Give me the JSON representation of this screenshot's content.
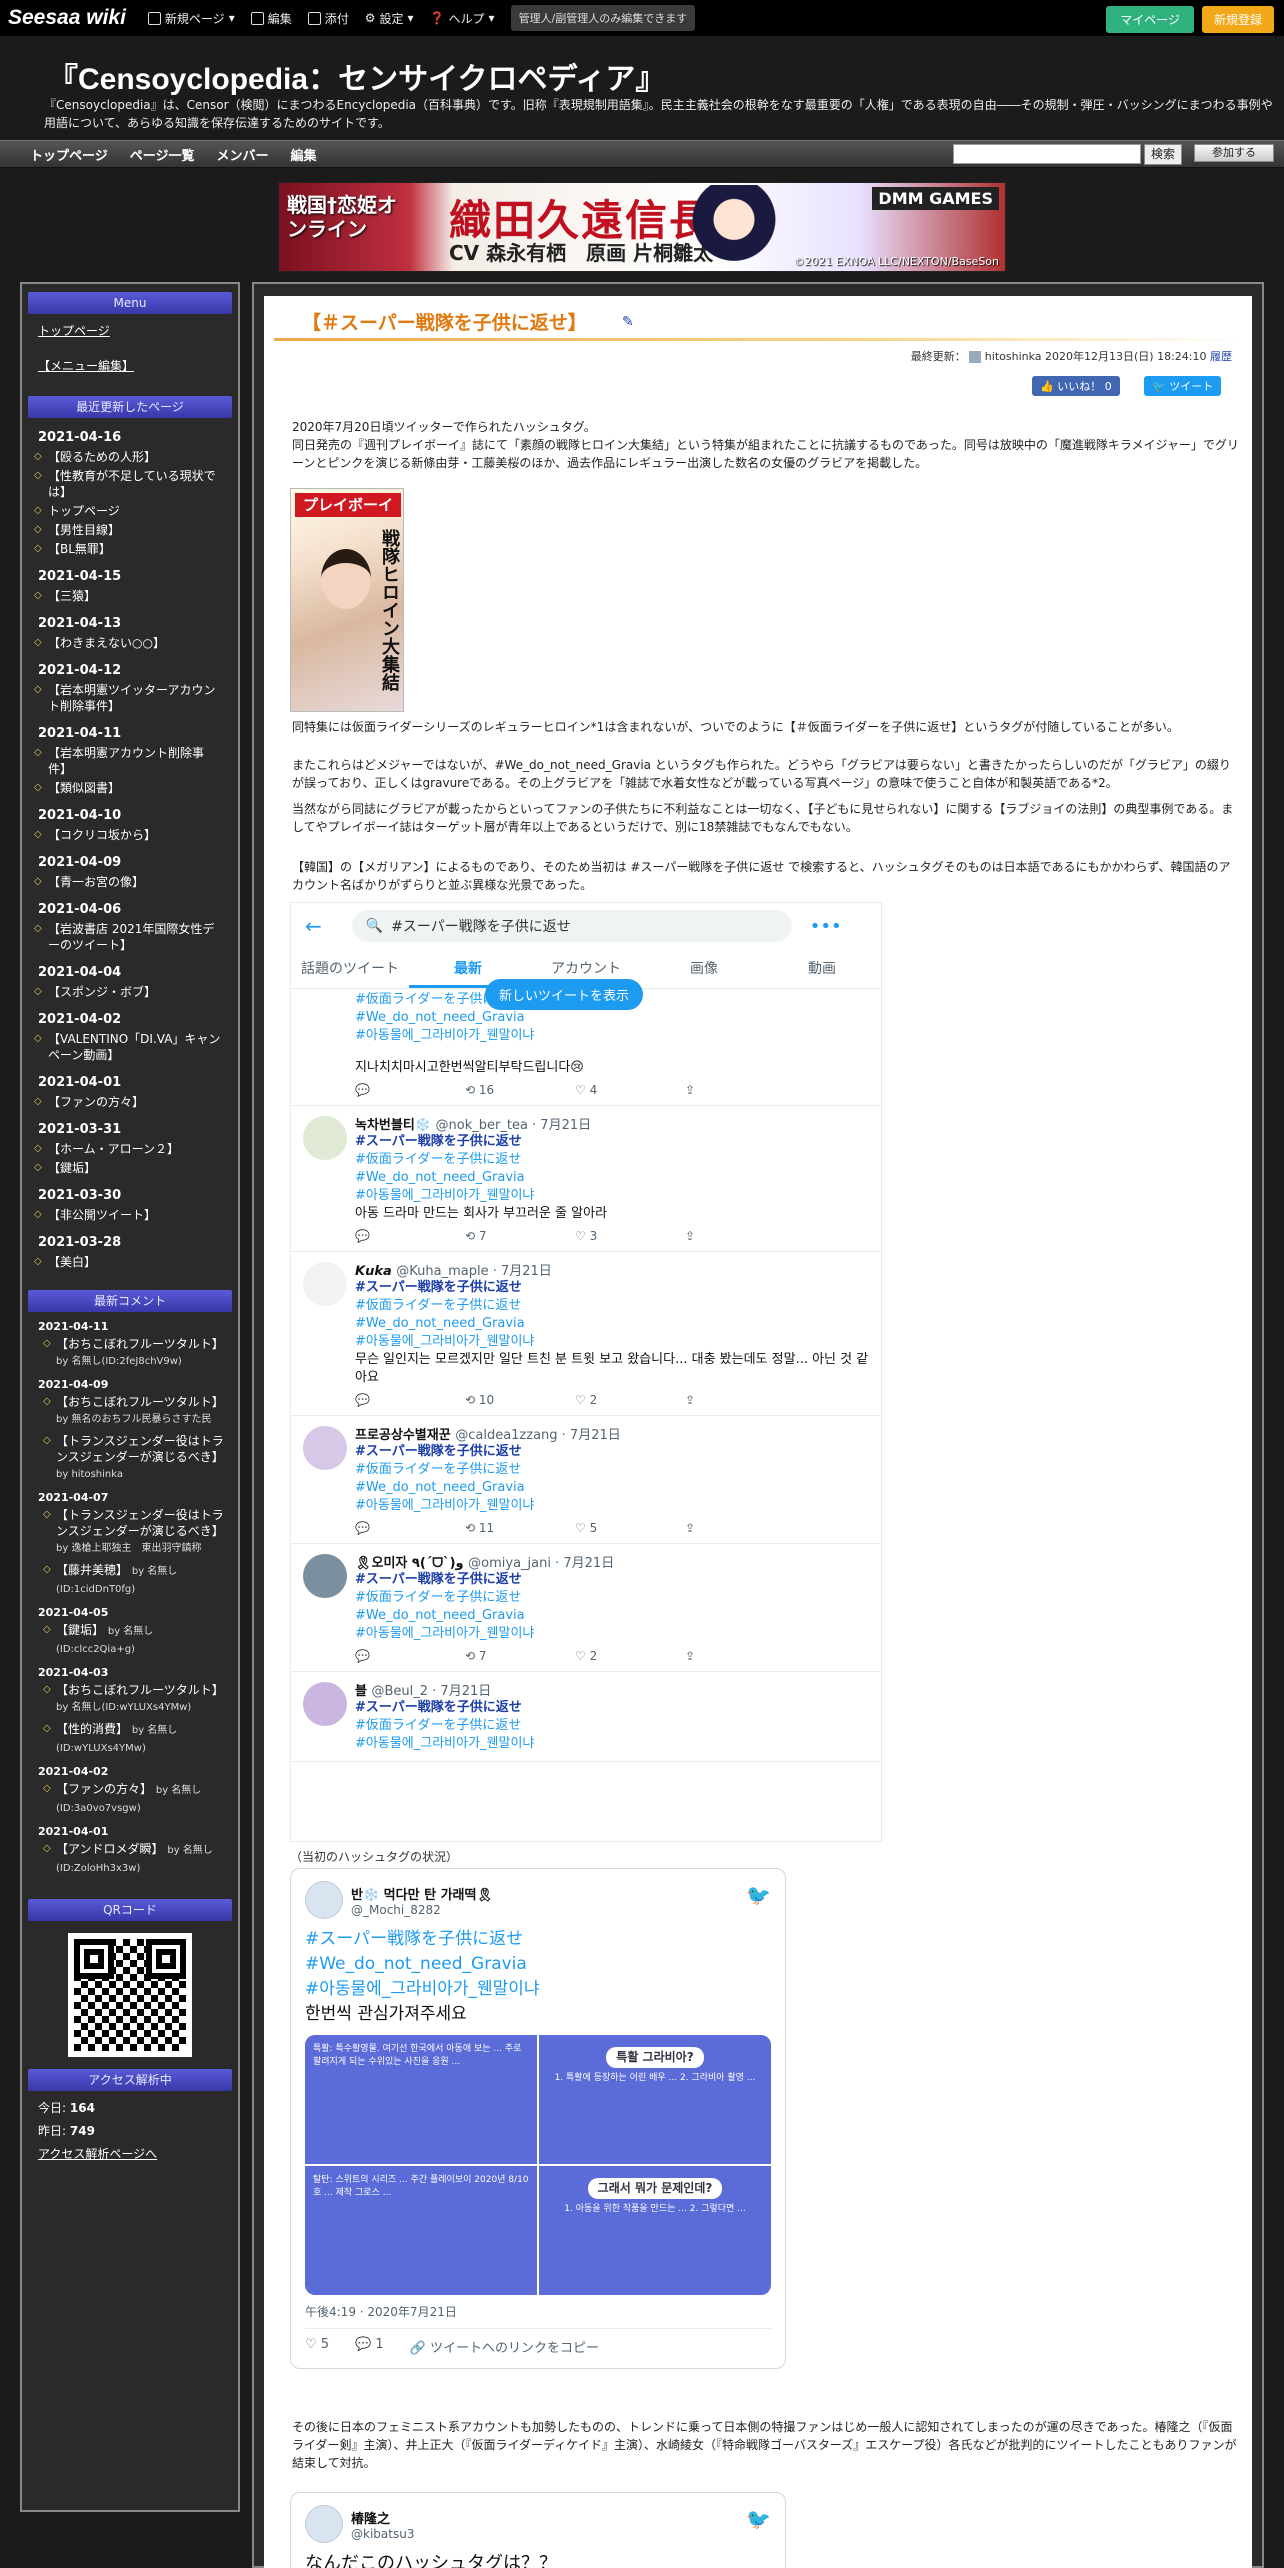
{
  "topbar": {
    "logo": "Seesaa wiki",
    "new_page": "新規ページ",
    "edit": "編集",
    "attach": "添付",
    "settings": "設定",
    "help": "ヘルプ",
    "note": "管理人/副管理人のみ編集できます",
    "mypage": "マイページ",
    "register": "新規登録"
  },
  "header": {
    "title": "『Censoyclopedia：センサイクロペディア』",
    "description": "『Censoyclopedia』は、Censor（検閲）にまつわるEncyclopedia（百科事典）です。旧称『表現規制用語集』。民主主義社会の根幹をなす最重要の「人権」である表現の自由――その規制・弾圧・バッシングにまつわる事例や用語について、あらゆる知識を保存伝達するためのサイトです。"
  },
  "nav": {
    "items": [
      "トップページ",
      "ページ一覧",
      "メンバー",
      "編集"
    ],
    "search_button": "検索",
    "join_button": "参加する"
  },
  "banner": {
    "left": "戦国†恋姫オンライン",
    "title_a": "織田",
    "title_b": "久遠",
    "title_c": "信長",
    "cast": "CV 森永有栖　原画 片桐雛太",
    "logo": "DMM GAMES",
    "copyright": "©2021 EXNOA LLC/NEXTON/BaseSon"
  },
  "sidebar": {
    "menu_head": "Menu",
    "menu_links": [
      "トップページ",
      "【メニュー編集】"
    ],
    "recent_head": "最近更新したページ",
    "recent": [
      {
        "date": "2021-04-16",
        "items": [
          "【殴るための人形】",
          "【性教育が不足している現状では】",
          "トップページ",
          "【男性目線】",
          "【BL無罪】"
        ]
      },
      {
        "date": "2021-04-15",
        "items": [
          "【三猿】"
        ]
      },
      {
        "date": "2021-04-13",
        "items": [
          "【わきまえない○○】"
        ]
      },
      {
        "date": "2021-04-12",
        "items": [
          "【岩本明憲ツイッターアカウント削除事件】"
        ]
      },
      {
        "date": "2021-04-11",
        "items": [
          "【岩本明憲アカウント削除事件】",
          "【類似図書】"
        ]
      },
      {
        "date": "2021-04-10",
        "items": [
          "【コクリコ坂から】"
        ]
      },
      {
        "date": "2021-04-09",
        "items": [
          "【青一お宮の像】"
        ]
      },
      {
        "date": "2021-04-06",
        "items": [
          "【岩波書店 2021年国際女性デーのツイート】"
        ]
      },
      {
        "date": "2021-04-04",
        "items": [
          "【スポンジ・ボブ】"
        ]
      },
      {
        "date": "2021-04-02",
        "items": [
          "【VALENTINO「DI.VA」キャンペーン動画】"
        ]
      },
      {
        "date": "2021-04-01",
        "items": [
          "【ファンの方々】"
        ]
      },
      {
        "date": "2021-03-31",
        "items": [
          "【ホーム・アローン２】",
          "【鍵垢】"
        ]
      },
      {
        "date": "2021-03-30",
        "items": [
          "【非公開ツイート】"
        ]
      },
      {
        "date": "2021-03-28",
        "items": [
          "【美白】"
        ]
      }
    ],
    "comments_head": "最新コメント",
    "comments": [
      {
        "date": "2021-04-11",
        "items": [
          {
            "t": "【おちこぼれフルーツタルト】",
            "by": "by 名無し(ID:2feJ8chV9w)"
          }
        ]
      },
      {
        "date": "2021-04-09",
        "items": [
          {
            "t": "【おちこぼれフルーツタルト】",
            "by": "by 無名のおちフル民暴らさすた民"
          },
          {
            "t": "【トランスジェンダー役はトランスジェンダーが演じるべき】",
            "by": "by hitoshinka"
          }
        ]
      },
      {
        "date": "2021-04-07",
        "items": [
          {
            "t": "【トランスジェンダー役はトランスジェンダーが演じるべき】",
            "by": "by 逸槍上耶独主　東出羽守鎮称"
          },
          {
            "t": "【藤井美穂】",
            "by": "by 名無し(ID:1cidDnT0fg)"
          }
        ]
      },
      {
        "date": "2021-04-05",
        "items": [
          {
            "t": "【鍵垢】",
            "by": "by 名無し(ID:clcc2Qia+g)"
          }
        ]
      },
      {
        "date": "2021-04-03",
        "items": [
          {
            "t": "【おちこぼれフルーツタルト】",
            "by": "by 名無し(ID:wYLUXs4YMw)"
          },
          {
            "t": "【性的消費】",
            "by": "by 名無し(ID:wYLUXs4YMw)"
          }
        ]
      },
      {
        "date": "2021-04-02",
        "items": [
          {
            "t": "【ファンの方々】",
            "by": "by 名無し(ID:3a0vo7vsgw)"
          }
        ]
      },
      {
        "date": "2021-04-01",
        "items": [
          {
            "t": "【アンドロメダ瞬】",
            "by": "by 名無し(ID:ZoloHh3x3w)"
          }
        ]
      }
    ],
    "qr_head": "QRコード",
    "access_head": "アクセス解析中",
    "today_label": "今日:",
    "today": "164",
    "yesterday_label": "昨日:",
    "yesterday": "749",
    "access_link": "アクセス解析ページへ"
  },
  "article": {
    "title": "【＃スーパー戦隊を子供に返せ】",
    "updated_label": "最終更新：",
    "updated_by": "hitoshinka",
    "updated_at": "2020年12月13日(日) 18:24:10",
    "history": "履歴",
    "like": "いいね！ 0",
    "tweet": "ツイート",
    "p1": "2020年7月20日頃ツイッターで作られたハッシュタグ。",
    "p2": "同日発売の『週刊プレイボーイ』誌にて「素顔の戦隊ヒロイン大集結」という特集が組まれたことに抗議するものであった。同号は放映中の「魔進戦隊キラメイジャー」でグリーンとピンクを演じる新條由芽・工藤美桜のほか、過去作品にレギュラー出演した数名の女優のグラビアを掲載した。",
    "magazine_title": "プレイボーイ",
    "magazine_side": "戦隊ヒロイン大集結",
    "p3": "同特集には仮面ライダーシリーズのレギュラーヒロイン*1は含まれないが、ついでのように【＃仮面ライダーを子供に返せ】というタグが付随していることが多い。",
    "p4": "またこれらはどメジャーではないが、#We_do_not_need_Gravia というタグも作られた。どうやら「グラビアは要らない」と書きたかったらしいのだが「グラビア」の綴りが誤っており、正しくはgravureである。その上グラビアを「雑誌で水着女性などが載っている写真ページ」の意味で使うこと自体が和製英語である*2。",
    "p5": "当然ながら同誌にグラビアが載ったからといってファンの子供たちに不利益なことは一切なく、【子どもに見せられない】に関する【ラブジョイの法則】の典型事例である。ましてやプレイボーイ誌はターゲット層が青年以上であるというだけで、別に18禁雑誌でもなんでもない。",
    "p6": "【韓国】の【メガリアン】によるものであり、そのため当初は #スーパー戦隊を子供に返せ で検索すると、ハッシュタグそのものは日本語であるにもかかわらず、韓国語のアカウント名ばかりがずらりと並ぶ異様な光景であった。",
    "caption1": "（当初のハッシュタグの状況）",
    "p7": "その後に日本のフェミニスト系アカウントも加勢したものの、トレンドに乗って日本側の特撮ファンはじめ一般人に認知されてしまったのが運の尽きであった。椿隆之（『仮面ライダー剣』主演）、井上正大（『仮面ライダーディケイド』主演）、水崎綾女（『特命戦隊ゴーバスターズ』エスケープ役）各氏などが批判的にツイートしたこともありファンが結束して対抗。"
  },
  "twitter_search": {
    "query": "#スーパー戦隊を子供に返せ",
    "tabs": [
      "話題のツイート",
      "最新",
      "アカウント",
      "画像",
      "動画"
    ],
    "new_tweets": "新しいツイートを表示",
    "tweets": [
      {
        "name": "",
        "handle": "",
        "tags": [
          "#仮面ライダーを子供に返せ",
          "#We_do_not_need_Gravia",
          "#아동물에_그라비아가_웬말이냐"
        ],
        "body": "지나치치마시고한번씩알티부탁드립니다😢",
        "rt": "16",
        "like": "4"
      },
      {
        "name": "녹차번블티❄️",
        "handle": "@nok_ber_tea · 7月21日",
        "tags": [
          "#スーパー戦隊を子供に返せ",
          "#仮面ライダーを子供に返せ",
          "#We_do_not_need_Gravia",
          "#아동물에_그라비아가_웬말이냐"
        ],
        "body": "아동 드라마 만드는 회사가 부끄러운 줄 알아라",
        "rt": "7",
        "like": "3"
      },
      {
        "name": "𝙆𝙪𝙠𝙖",
        "handle": "@Kuha_maple · 7月21日",
        "tags": [
          "#スーパー戦隊を子供に返せ",
          "#仮面ライダーを子供に返せ",
          "#We_do_not_need_Gravia",
          "#아동물에_그라비아가_웬말이냐"
        ],
        "body": "무슨 일인지는 모르겠지만 일단 트친 분 트윗 보고 왔습니다... 대충 봤는데도 정말... 아닌 것 같아요",
        "rt": "10",
        "like": "2"
      },
      {
        "name": "프로공상수별재꾼",
        "handle": "@caldea1zzang · 7月21日",
        "tags": [
          "#スーパー戦隊を子供に返せ",
          "#仮面ライダーを子供に返せ",
          "#We_do_not_need_Gravia",
          "#아동물에_그라비아가_웬말이냐"
        ],
        "body": "",
        "rt": "11",
        "like": "5"
      },
      {
        "name": "🎗오미자 ٩(ˊᗜˋ)و",
        "handle": "@omiya_jani · 7月21日",
        "tags": [
          "#スーパー戦隊を子供に返せ",
          "#仮面ライダーを子供に返せ",
          "#We_do_not_need_Gravia",
          "#아동물에_그라비아가_웬말이냐"
        ],
        "body": "",
        "rt": "7",
        "like": "2"
      },
      {
        "name": "블",
        "handle": "@Beul_2 · 7月21日",
        "tags": [
          "#スーパー戦隊を子供に返せ",
          "#仮面ライダーを子供に返せ",
          "#아동물에_그라비아가_웬말이냐"
        ],
        "body": "",
        "rt": "",
        "like": ""
      }
    ]
  },
  "embed1": {
    "name": "반❄️ 먹다만 탄 가래떡🎗",
    "handle": "@_Mochi_8282",
    "tags": [
      "#スーパー戦隊を子供に返せ",
      "#We_do_not_need_Gravia",
      "#아동물에_그라비아가_웬말이냐"
    ],
    "text": "한번씩 관심가져주세요",
    "panel_titles": [
      "",
      "특활 그라비아?",
      "",
      "그래서 뭐가 문제인데?"
    ],
    "time": "午後4:19 · 2020年7月21日",
    "likes": "5",
    "replies": "1",
    "copy_link": "ツイートへのリンクをコピー"
  },
  "embed2": {
    "name": "椿隆之",
    "handle": "@kibatsu3",
    "text": "なんだこのハッシュタグは？？"
  },
  "colors": {
    "accent": "#e07a10",
    "twitter": "#1d9bf0",
    "sidebar_head": "#4646c0"
  }
}
